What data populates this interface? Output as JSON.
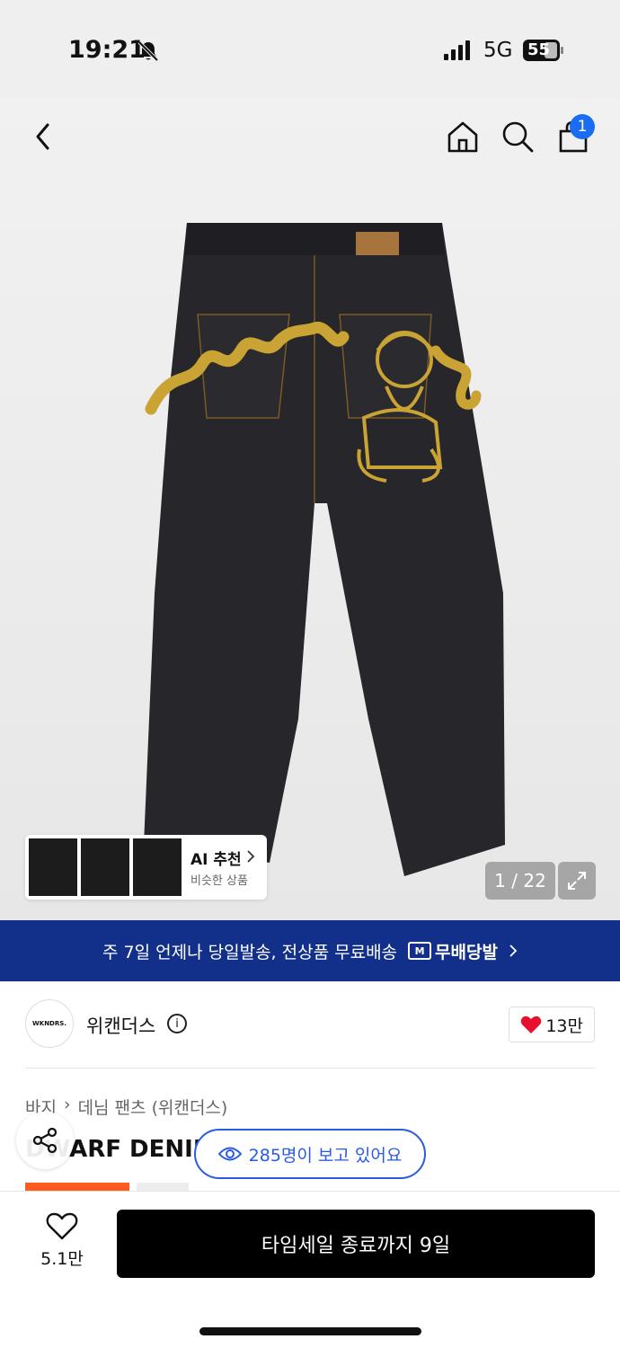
{
  "status_bar": {
    "time": "19:21",
    "network": "5G",
    "battery": "55"
  },
  "product_gallery": {
    "page_counter": "1 / 22"
  },
  "header": {
    "cart_count": "1"
  },
  "ai_recommend": {
    "title": "AI 추천",
    "subtitle": "비슷한 상품"
  },
  "delivery_banner": {
    "text": "주 7일 언제나 당일발송, 전상품 무료배송",
    "brand": "무배당발",
    "brand_badge": "M"
  },
  "brand": {
    "logo_text": "WKNDRS.",
    "name": "위캔더스",
    "likes": "13만"
  },
  "breadcrumb": [
    "바지",
    "데님 팬츠 (위캔더스)"
  ],
  "product": {
    "title": "DWARF DENIM"
  },
  "viewers": {
    "text": "285명이 보고 있어요"
  },
  "bottom_bar": {
    "wish_count": "5.1만",
    "cta_label": "타임세일 종료까지 9일"
  },
  "colors": {
    "banner": "#12308a",
    "accent_blue": "#2a5be0",
    "heart": "#e8112d",
    "badge": "#1b6cf2"
  }
}
